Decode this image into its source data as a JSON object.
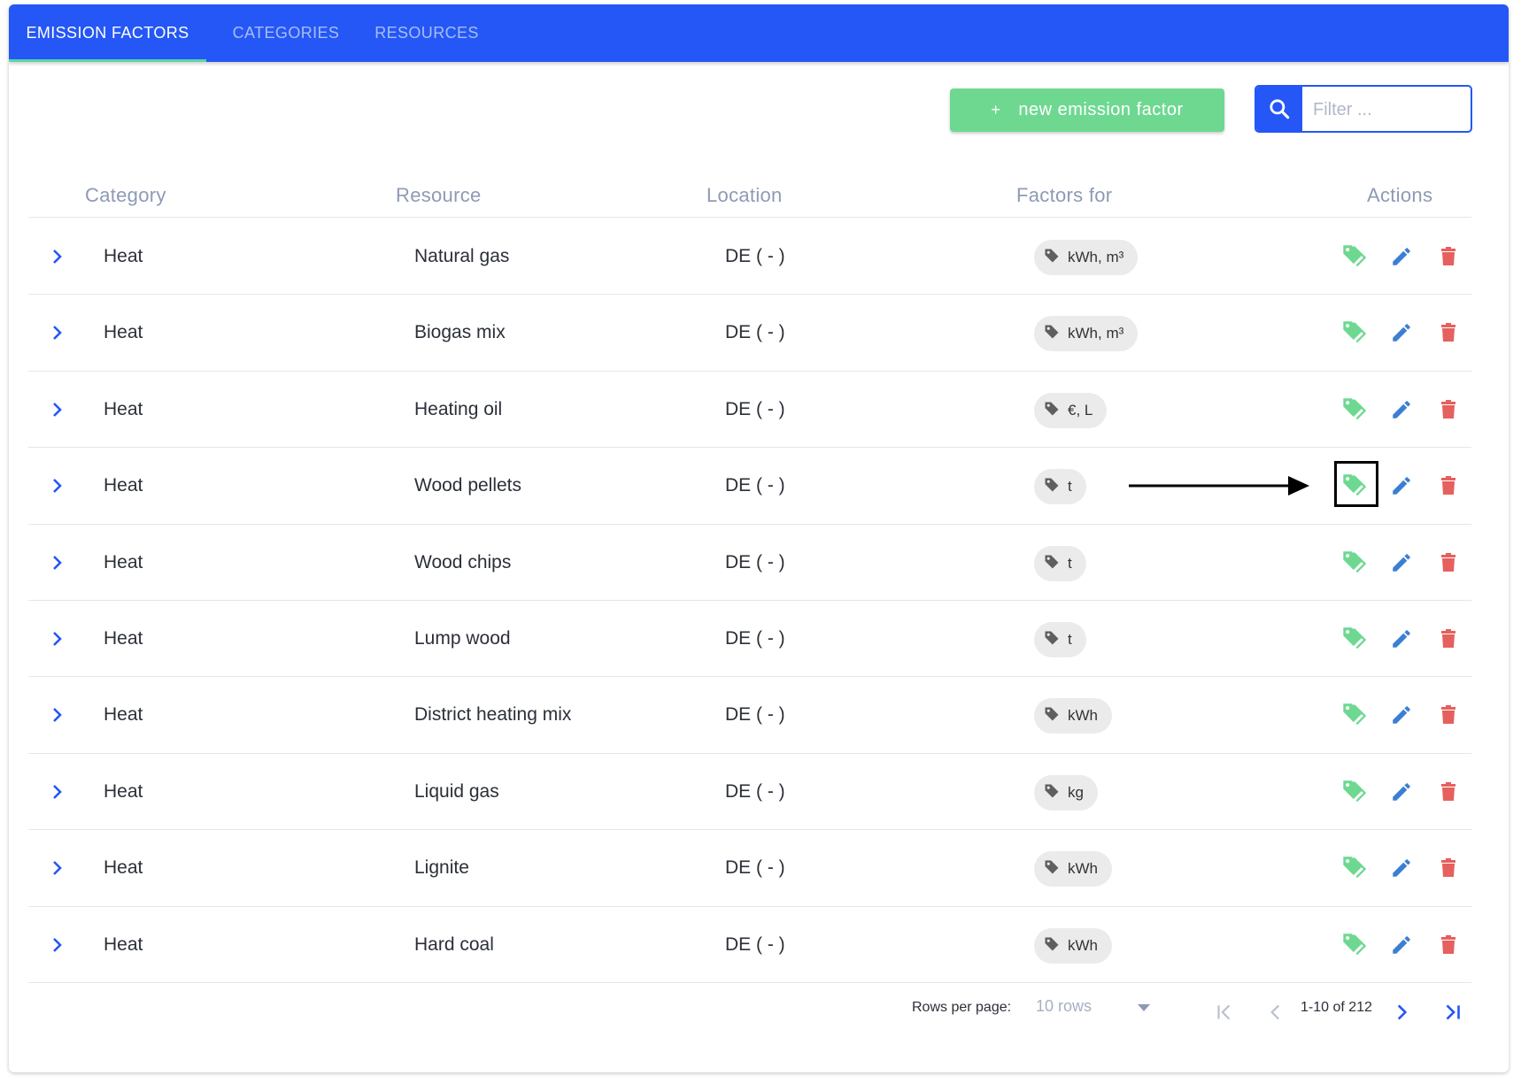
{
  "tabs": [
    {
      "label": "EMISSION FACTORS",
      "active": true
    },
    {
      "label": "CATEGORIES",
      "active": false
    },
    {
      "label": "RESOURCES",
      "active": false
    }
  ],
  "toolbar": {
    "new_button_label": "new emission factor",
    "new_button_icon": "plus-icon",
    "search_icon": "search-icon",
    "filter_placeholder": "Filter ..."
  },
  "table": {
    "headers": {
      "category": "Category",
      "resource": "Resource",
      "location": "Location",
      "factors_for": "Factors for",
      "actions": "Actions"
    },
    "rows": [
      {
        "category": "Heat",
        "resource": "Natural gas",
        "location": "DE ( - )",
        "factors_for": "kWh, m³"
      },
      {
        "category": "Heat",
        "resource": "Biogas mix",
        "location": "DE ( - )",
        "factors_for": "kWh, m³"
      },
      {
        "category": "Heat",
        "resource": "Heating oil",
        "location": "DE ( - )",
        "factors_for": "€, L"
      },
      {
        "category": "Heat",
        "resource": "Wood pellets",
        "location": "DE ( - )",
        "factors_for": "t"
      },
      {
        "category": "Heat",
        "resource": "Wood chips",
        "location": "DE ( - )",
        "factors_for": "t"
      },
      {
        "category": "Heat",
        "resource": "Lump wood",
        "location": "DE ( - )",
        "factors_for": "t"
      },
      {
        "category": "Heat",
        "resource": "District heating mix",
        "location": "DE ( - )",
        "factors_for": "kWh"
      },
      {
        "category": "Heat",
        "resource": "Liquid gas",
        "location": "DE ( - )",
        "factors_for": "kg"
      },
      {
        "category": "Heat",
        "resource": "Lignite",
        "location": "DE ( - )",
        "factors_for": "kWh"
      },
      {
        "category": "Heat",
        "resource": "Hard coal",
        "location": "DE ( - )",
        "factors_for": "kWh"
      }
    ],
    "action_icons": [
      "tag-icon",
      "pencil-icon",
      "trash-icon"
    ]
  },
  "pagination": {
    "rows_per_page_label": "Rows per page:",
    "rows_per_page_value": "10 rows",
    "range_text": "1-10 of 212"
  },
  "colors": {
    "primary": "#2457f5",
    "tab_indicator": "#5cd6a3",
    "new_button": "#6ed891",
    "tag_icon": "#6ed891",
    "edit_icon": "#3b7fd4",
    "delete_icon": "#e5605e",
    "header_text": "#8e9ab5"
  }
}
